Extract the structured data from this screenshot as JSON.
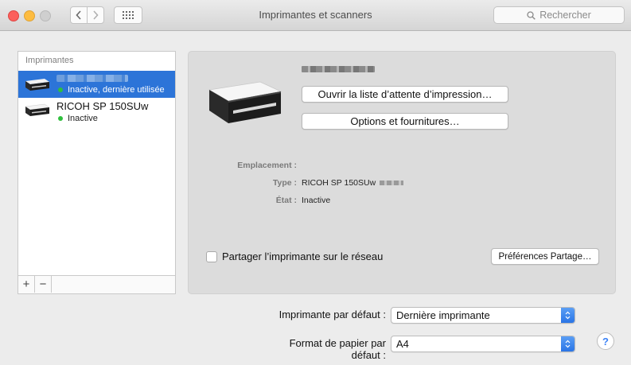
{
  "window": {
    "title": "Imprimantes et scanners",
    "search_placeholder": "Rechercher"
  },
  "sidebar": {
    "header": "Imprimantes",
    "items": [
      {
        "name": "",
        "status": "Inactive, dernière utilisée",
        "selected": true,
        "status_color": "#2fc03d"
      },
      {
        "name": "RICOH SP 150SUw",
        "status": "Inactive",
        "selected": false,
        "status_color": "#2fc03d"
      }
    ],
    "add_label": "+",
    "remove_label": "−"
  },
  "detail": {
    "open_queue_label": "Ouvrir la liste d’attente d’impression…",
    "options_label": "Options et fournitures…",
    "location_label": "Emplacement :",
    "location_value": "",
    "type_label": "Type :",
    "type_value": "RICOH SP 150SUw",
    "state_label": "État :",
    "state_value": "Inactive",
    "share_label": "Partager l’imprimante sur le réseau",
    "share_checked": false,
    "share_prefs_label": "Préférences Partage…"
  },
  "defaults": {
    "printer_label": "Imprimante par défaut :",
    "printer_value": "Dernière imprimante",
    "paper_label": "Format de papier par défaut :",
    "paper_value": "A4"
  },
  "help_label": "?",
  "colors": {
    "selection": "#2c74d8",
    "accent": "#2a75e6",
    "status_green": "#2fc03d"
  }
}
